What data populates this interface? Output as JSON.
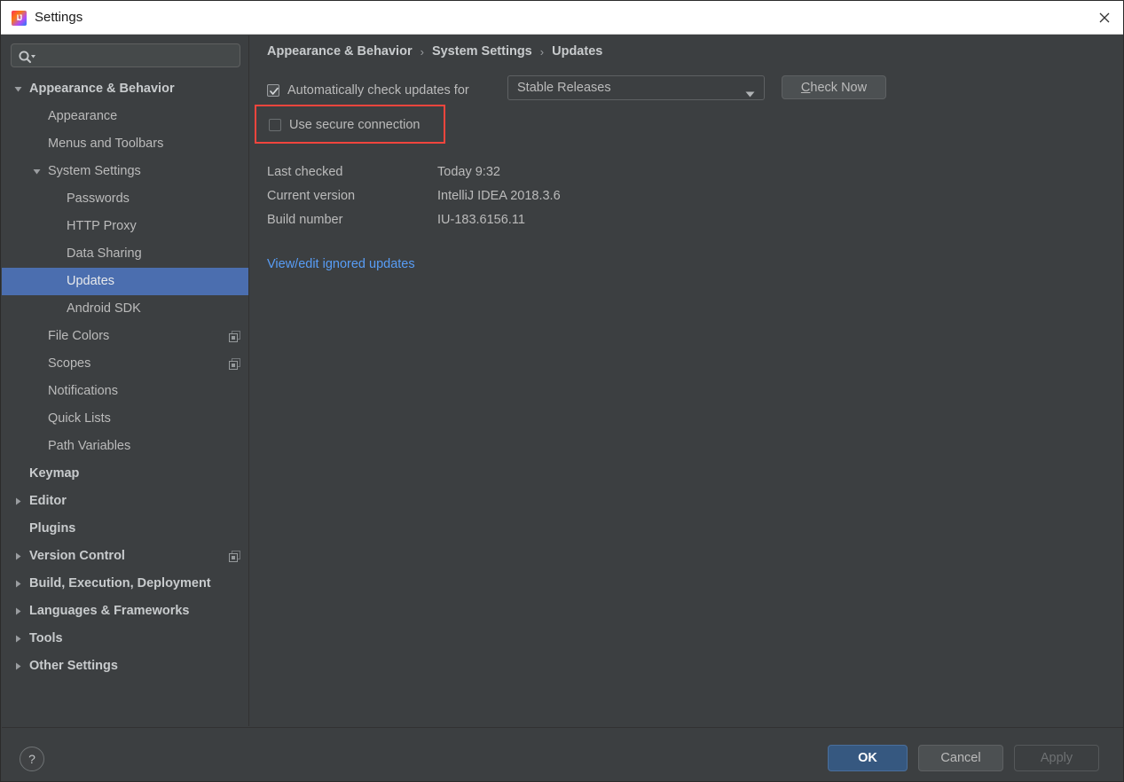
{
  "window": {
    "title": "Settings",
    "logo_icon": "intellij-idea-logo",
    "close_icon": "close-icon"
  },
  "sidebar": {
    "search": {
      "placeholder": "",
      "value": "",
      "icon": "search-icon"
    },
    "items": [
      {
        "label": "Appearance & Behavior",
        "depth": 0,
        "arrow": "down",
        "bold": true,
        "selected": false,
        "badge": false
      },
      {
        "label": "Appearance",
        "depth": 1,
        "arrow": "none",
        "bold": false,
        "selected": false,
        "badge": false
      },
      {
        "label": "Menus and Toolbars",
        "depth": 1,
        "arrow": "none",
        "bold": false,
        "selected": false,
        "badge": false
      },
      {
        "label": "System Settings",
        "depth": 1,
        "arrow": "down",
        "bold": false,
        "selected": false,
        "badge": false
      },
      {
        "label": "Passwords",
        "depth": 2,
        "arrow": "none",
        "bold": false,
        "selected": false,
        "badge": false
      },
      {
        "label": "HTTP Proxy",
        "depth": 2,
        "arrow": "none",
        "bold": false,
        "selected": false,
        "badge": false
      },
      {
        "label": "Data Sharing",
        "depth": 2,
        "arrow": "none",
        "bold": false,
        "selected": false,
        "badge": false
      },
      {
        "label": "Updates",
        "depth": 2,
        "arrow": "none",
        "bold": false,
        "selected": true,
        "badge": false
      },
      {
        "label": "Android SDK",
        "depth": 2,
        "arrow": "none",
        "bold": false,
        "selected": false,
        "badge": false
      },
      {
        "label": "File Colors",
        "depth": 1,
        "arrow": "none",
        "bold": false,
        "selected": false,
        "badge": true
      },
      {
        "label": "Scopes",
        "depth": 1,
        "arrow": "none",
        "bold": false,
        "selected": false,
        "badge": true
      },
      {
        "label": "Notifications",
        "depth": 1,
        "arrow": "none",
        "bold": false,
        "selected": false,
        "badge": false
      },
      {
        "label": "Quick Lists",
        "depth": 1,
        "arrow": "none",
        "bold": false,
        "selected": false,
        "badge": false
      },
      {
        "label": "Path Variables",
        "depth": 1,
        "arrow": "none",
        "bold": false,
        "selected": false,
        "badge": false
      },
      {
        "label": "Keymap",
        "depth": 0,
        "arrow": "none",
        "bold": true,
        "selected": false,
        "badge": false
      },
      {
        "label": "Editor",
        "depth": 0,
        "arrow": "right",
        "bold": true,
        "selected": false,
        "badge": false
      },
      {
        "label": "Plugins",
        "depth": 0,
        "arrow": "none",
        "bold": true,
        "selected": false,
        "badge": false
      },
      {
        "label": "Version Control",
        "depth": 0,
        "arrow": "right",
        "bold": true,
        "selected": false,
        "badge": true
      },
      {
        "label": "Build, Execution, Deployment",
        "depth": 0,
        "arrow": "right",
        "bold": true,
        "selected": false,
        "badge": false
      },
      {
        "label": "Languages & Frameworks",
        "depth": 0,
        "arrow": "right",
        "bold": true,
        "selected": false,
        "badge": false
      },
      {
        "label": "Tools",
        "depth": 0,
        "arrow": "right",
        "bold": true,
        "selected": false,
        "badge": false
      },
      {
        "label": "Other Settings",
        "depth": 0,
        "arrow": "right",
        "bold": true,
        "selected": false,
        "badge": false
      }
    ]
  },
  "content": {
    "breadcrumb": {
      "parts": [
        "Appearance & Behavior",
        "System Settings",
        "Updates"
      ],
      "separator": "›"
    },
    "auto_check": {
      "label": "Automatically check updates for",
      "checked": true
    },
    "channel": {
      "value": "Stable Releases",
      "arrow_icon": "chevron-down-icon"
    },
    "check_now": {
      "mnemonic": "C",
      "rest": "heck Now"
    },
    "secure_connection": {
      "label": "Use secure connection",
      "checked": false,
      "highlight_color": "#f2453d"
    },
    "info_rows": [
      {
        "key": "Last checked",
        "value": "Today 9:32"
      },
      {
        "key": "Current version",
        "value": "IntelliJ IDEA 2018.3.6"
      },
      {
        "key": "Build number",
        "value": "IU-183.6156.11"
      }
    ],
    "ignored_link": "View/edit ignored updates"
  },
  "footer": {
    "help_label": "?",
    "ok_label": "OK",
    "cancel_label": "Cancel",
    "apply_label": "Apply"
  },
  "colors": {
    "background": "#3c3f41",
    "selection": "#4b6eaf",
    "link": "#589df6",
    "accent_ok": "#365880",
    "annotation": "#f2453d"
  }
}
